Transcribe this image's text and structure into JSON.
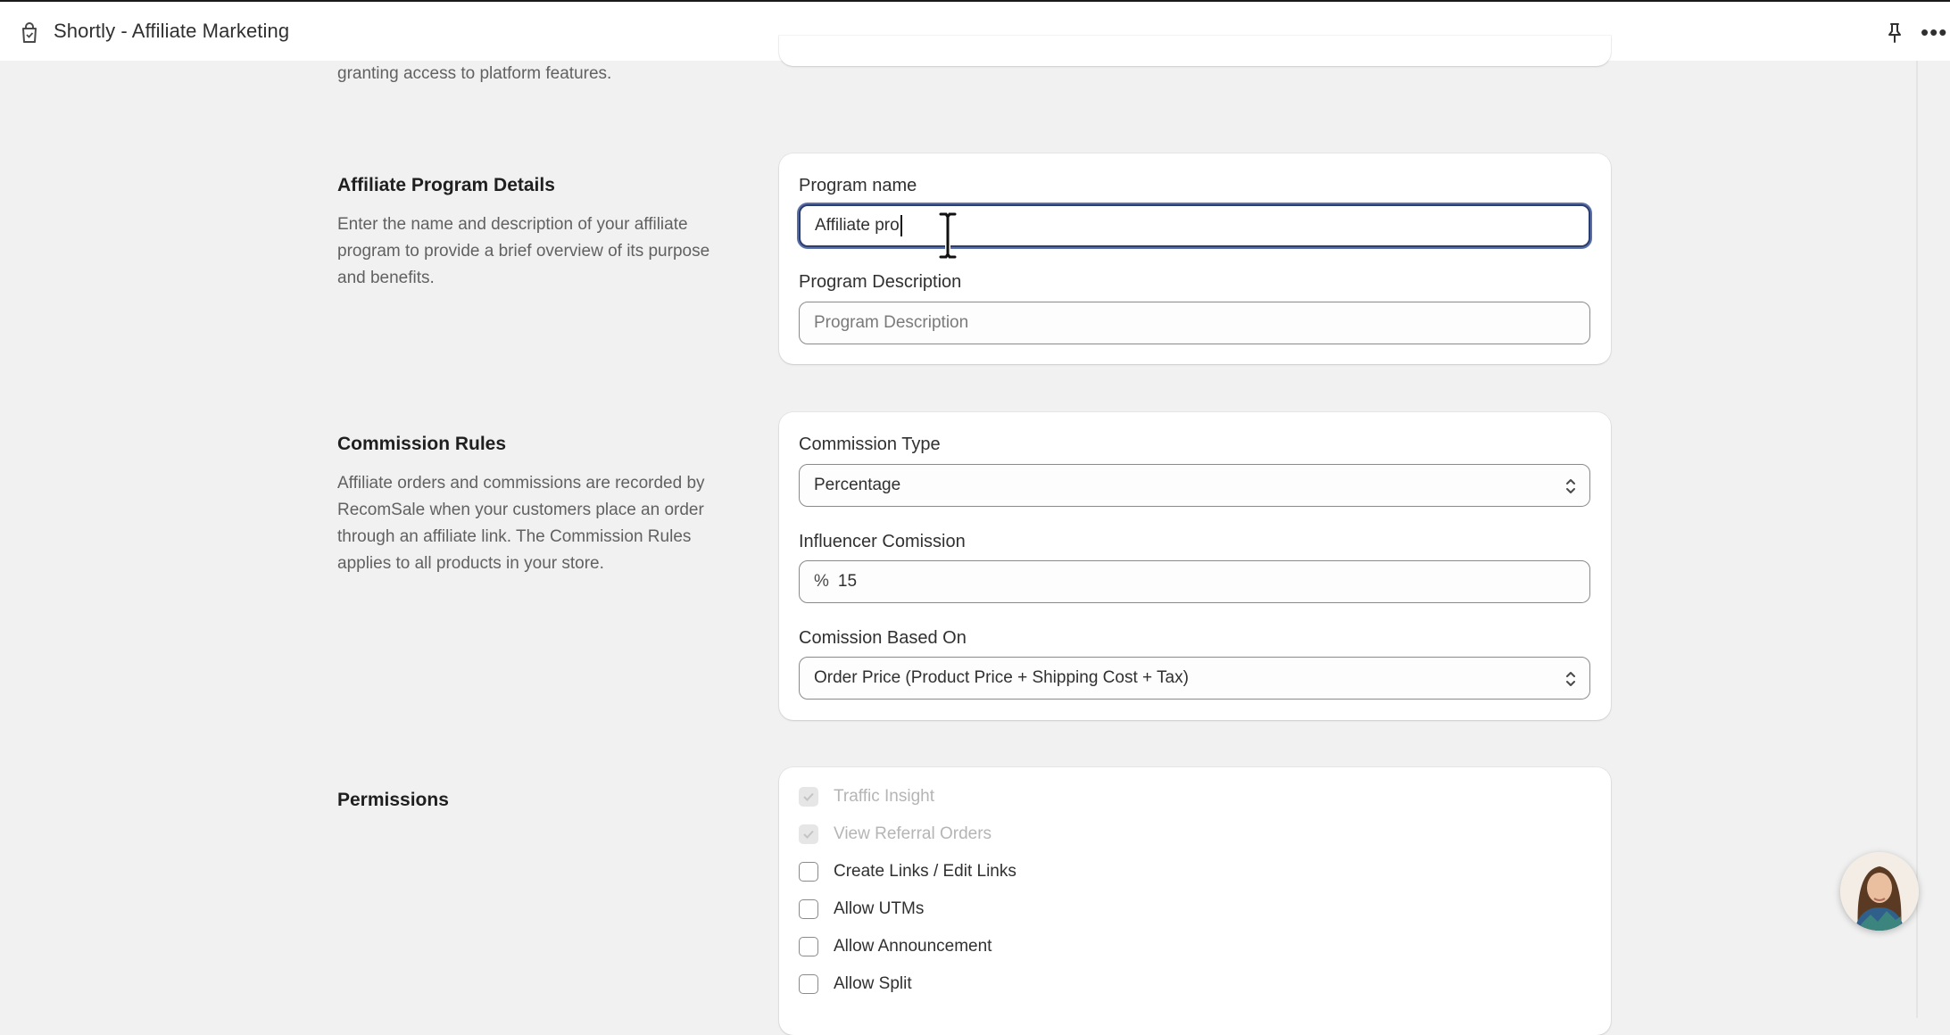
{
  "app": {
    "title": "Shortly - Affiliate Marketing"
  },
  "previous_section": {
    "desc_tail": "granting access to platform features."
  },
  "program_details": {
    "title": "Affiliate Program Details",
    "description": "Enter the name and description of your affiliate program to provide a brief overview of its purpose and benefits.",
    "name_label": "Program name",
    "name_value": "Affiliate pro",
    "desc_label": "Program Description",
    "desc_placeholder": "Program Description"
  },
  "commission_rules": {
    "title": "Commission Rules",
    "description": "Affiliate orders and commissions are recorded by RecomSale when your customers place an order through an affiliate link. The Commission Rules applies to all products in your store.",
    "type_label": "Commission Type",
    "type_value": "Percentage",
    "influencer_label": "Influencer Comission",
    "influencer_prefix": "%",
    "influencer_value": "15",
    "based_on_label": "Comission Based On",
    "based_on_value": "Order Price (Product Price + Shipping Cost + Tax)"
  },
  "permissions": {
    "title": "Permissions",
    "items": [
      {
        "label": "Traffic Insight",
        "checked": true,
        "disabled": true
      },
      {
        "label": "View Referral Orders",
        "checked": true,
        "disabled": true
      },
      {
        "label": "Create Links / Edit Links",
        "checked": false,
        "disabled": false
      },
      {
        "label": "Allow UTMs",
        "checked": false,
        "disabled": false
      },
      {
        "label": "Allow Announcement",
        "checked": false,
        "disabled": false
      },
      {
        "label": "Allow Split",
        "checked": false,
        "disabled": false
      }
    ]
  },
  "icons": {
    "app": "shopping-bag-icon",
    "pin": "pin-icon",
    "more": "more-horizontal-icon",
    "select": "chevron-up-down-icon",
    "checkmark": "checkmark-icon",
    "cursor": "text-cursor-icon",
    "chat": "support-avatar"
  },
  "colors": {
    "focus_ring": "#2c3e6e",
    "background": "#f1f1f1",
    "card": "#ffffff"
  }
}
